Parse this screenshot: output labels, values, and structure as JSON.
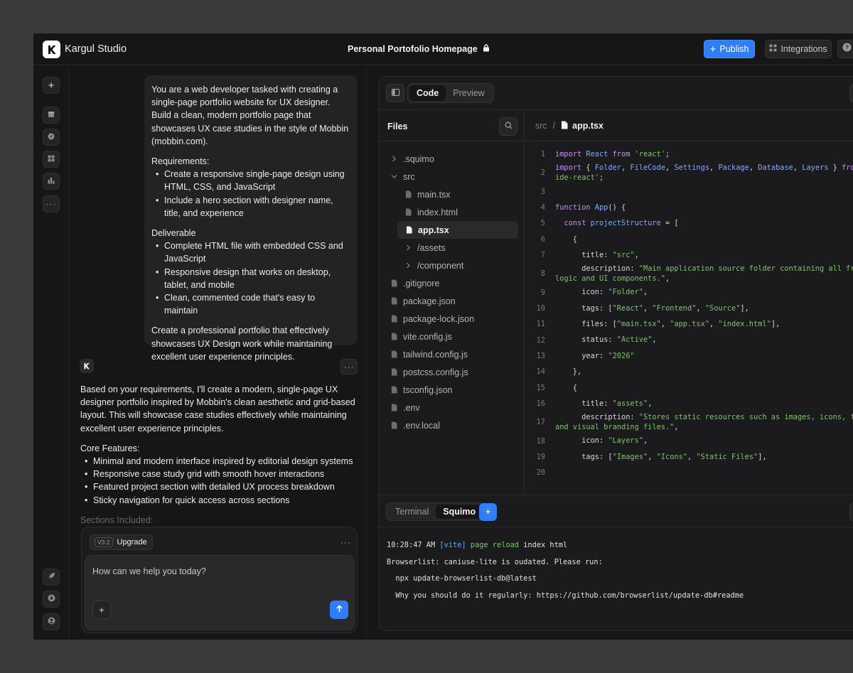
{
  "header": {
    "brand": "Kargul Studio",
    "doc_title": "Personal Portofolio Homepage",
    "publish_label": "Publish",
    "integrations_label": "Integrations"
  },
  "rail": {
    "icons": [
      "plus-icon",
      "box-icon",
      "compass-icon",
      "grid-icon",
      "bar-chart-icon",
      "more-icon",
      "rocket-icon",
      "download-icon",
      "user-icon"
    ]
  },
  "chat": {
    "user_message": {
      "intro": "You are a web developer tasked with creating a single-page portfolio website for UX designer. Build a clean, modern portfolio page that showcases UX case studies in the style of Mobbin (mobbin.com).",
      "requirements_title": "Requirements:",
      "requirements": [
        "Create a responsive single-page design using HTML, CSS, and JavaScript",
        "Include a hero section with designer name, title, and experience"
      ],
      "deliverable_title": "Deliverable",
      "deliverables": [
        "Complete HTML file with embedded CSS and JavaScript",
        "Responsive design that works on desktop, tablet, and mobile",
        "Clean, commented code that's easy to maintain"
      ],
      "closing": "Create a professional portfolio that effectively showcases UX Design work while maintaining excellent user experience principles."
    },
    "ai_message": {
      "intro": "Based on your requirements, I'll create a modern, single-page UX designer portfolio inspired by Mobbin's clean aesthetic and grid-based layout. This will showcase case studies effectively while maintaining excellent user experience principles.",
      "features_title": "Core Features:",
      "features": [
        "Minimal and modern interface inspired by editorial design systems",
        "Responsive case study grid with smooth hover interactions",
        "Featured project section with detailed UX process breakdown",
        "Sticky navigation for quick access across sections"
      ],
      "sections_title": "Sections Included:"
    },
    "composer": {
      "version": "V3.2",
      "upgrade_label": "Upgrade",
      "placeholder": "How can we help you today?"
    }
  },
  "panel": {
    "tabs": [
      "Code",
      "Preview"
    ],
    "active_tab": "Code",
    "files_title": "Files",
    "tree": [
      {
        "name": ".squimo",
        "type": "folder-collapsed",
        "depth": 0
      },
      {
        "name": "src",
        "type": "folder-open",
        "depth": 0
      },
      {
        "name": "main.tsx",
        "type": "file",
        "depth": 1
      },
      {
        "name": "index.html",
        "type": "file",
        "depth": 1
      },
      {
        "name": "app.tsx",
        "type": "file",
        "depth": 1,
        "selected": true
      },
      {
        "name": "/assets",
        "type": "folder-collapsed",
        "depth": 1
      },
      {
        "name": "/component",
        "type": "folder-collapsed",
        "depth": 1
      },
      {
        "name": ".gitignore",
        "type": "file",
        "depth": 0
      },
      {
        "name": "package.json",
        "type": "file",
        "depth": 0
      },
      {
        "name": "package-lock.json",
        "type": "file",
        "depth": 0
      },
      {
        "name": "vite.config.js",
        "type": "file",
        "depth": 0
      },
      {
        "name": "tailwind.config.js",
        "type": "file",
        "depth": 0
      },
      {
        "name": "postcss.config.js",
        "type": "file",
        "depth": 0
      },
      {
        "name": "tsconfig.json",
        "type": "file",
        "depth": 0
      },
      {
        "name": ".env",
        "type": "file",
        "depth": 0
      },
      {
        "name": ".env.local",
        "type": "file",
        "depth": 0
      }
    ],
    "breadcrumb_dir": "src",
    "breadcrumb_sep": "/",
    "breadcrumb_file": "app.tsx",
    "code_lines": [
      {
        "n": "1",
        "tokens": [
          [
            "kw",
            "import"
          ],
          [
            "p",
            " "
          ],
          [
            "id",
            "React"
          ],
          [
            "p",
            " "
          ],
          [
            "kw",
            "from"
          ],
          [
            "p",
            " "
          ],
          [
            "str",
            "'react'"
          ],
          [
            "p",
            ";"
          ]
        ]
      },
      {
        "n": "2",
        "two": true,
        "tokens": [
          [
            "kw",
            "import"
          ],
          [
            "p",
            " { "
          ],
          [
            "id",
            "Folder"
          ],
          [
            "p",
            ", "
          ],
          [
            "id",
            "FileCode"
          ],
          [
            "p",
            ", "
          ],
          [
            "id",
            "Settings"
          ],
          [
            "p",
            ", "
          ],
          [
            "id",
            "Package"
          ],
          [
            "p",
            ", "
          ],
          [
            "id",
            "Database"
          ],
          [
            "p",
            ", "
          ],
          [
            "id",
            "Layers"
          ],
          [
            "p",
            " } "
          ],
          [
            "kw",
            "from"
          ],
          [
            "p",
            " '"
          ],
          [
            "str",
            "luc\nide-react"
          ],
          [
            "str",
            "'"
          ],
          [
            "p",
            ";"
          ]
        ]
      },
      {
        "n": "3",
        "tokens": []
      },
      {
        "n": "4",
        "tokens": [
          [
            "kw",
            "function"
          ],
          [
            "p",
            " "
          ],
          [
            "id",
            "App"
          ],
          [
            "p",
            "() {"
          ]
        ]
      },
      {
        "n": "5",
        "tokens": [
          [
            "p",
            "  "
          ],
          [
            "kw",
            "const"
          ],
          [
            "p",
            " "
          ],
          [
            "id",
            "projectStructure"
          ],
          [
            "p",
            " = ["
          ]
        ]
      },
      {
        "n": "6",
        "tokens": [
          [
            "p",
            "    {"
          ]
        ]
      },
      {
        "n": "7",
        "tokens": [
          [
            "p",
            "      title: "
          ],
          [
            "str",
            "\"src\""
          ],
          [
            "p",
            ","
          ]
        ]
      },
      {
        "n": "8",
        "two": true,
        "tokens": [
          [
            "p",
            "      description: "
          ],
          [
            "str",
            "\"Main application source folder containing all front\nlogic and UI components.\""
          ],
          [
            "p",
            ","
          ]
        ]
      },
      {
        "n": "9",
        "tokens": [
          [
            "p",
            "      icon: "
          ],
          [
            "str",
            "\"Folder\""
          ],
          [
            "p",
            ","
          ]
        ]
      },
      {
        "n": "10",
        "tokens": [
          [
            "p",
            "      tags: ["
          ],
          [
            "str",
            "\"React\""
          ],
          [
            "p",
            ", "
          ],
          [
            "str",
            "\"Frontend\""
          ],
          [
            "p",
            ", "
          ],
          [
            "str",
            "\"Source\""
          ],
          [
            "p",
            "],"
          ]
        ]
      },
      {
        "n": "11",
        "tokens": [
          [
            "p",
            "      files: ["
          ],
          [
            "str",
            "\"main.tsx\""
          ],
          [
            "p",
            ", "
          ],
          [
            "str",
            "\"app.tsx\""
          ],
          [
            "p",
            ", "
          ],
          [
            "str",
            "\"index.html\""
          ],
          [
            "p",
            "],"
          ]
        ]
      },
      {
        "n": "12",
        "tokens": [
          [
            "p",
            "      status: "
          ],
          [
            "str",
            "\"Active\""
          ],
          [
            "p",
            ","
          ]
        ]
      },
      {
        "n": "13",
        "tokens": [
          [
            "p",
            "      year: "
          ],
          [
            "str",
            "\"2026\""
          ]
        ]
      },
      {
        "n": "14",
        "tokens": [
          [
            "p",
            "    },"
          ]
        ]
      },
      {
        "n": "15",
        "tokens": [
          [
            "p",
            "    {"
          ]
        ]
      },
      {
        "n": "16",
        "tokens": [
          [
            "p",
            "      title: "
          ],
          [
            "str",
            "\"assets\""
          ],
          [
            "p",
            ","
          ]
        ]
      },
      {
        "n": "17",
        "two": true,
        "tokens": [
          [
            "p",
            "      description: "
          ],
          [
            "str",
            "\"Stores static resources such as images, icons, font\nand visual branding files.\""
          ],
          [
            "p",
            ","
          ]
        ]
      },
      {
        "n": "18",
        "tokens": [
          [
            "p",
            "      icon: "
          ],
          [
            "str",
            "\"Layers\""
          ],
          [
            "p",
            ","
          ]
        ]
      },
      {
        "n": "19",
        "tokens": [
          [
            "p",
            "      tags: ["
          ],
          [
            "str",
            "\"Images\""
          ],
          [
            "p",
            ", "
          ],
          [
            "str",
            "\"Icons\""
          ],
          [
            "p",
            ", "
          ],
          [
            "str",
            "\"Static Files\""
          ],
          [
            "p",
            "],"
          ]
        ]
      },
      {
        "n": "20",
        "tokens": []
      }
    ],
    "terminal_tabs": [
      "Terminal",
      "Squimo"
    ],
    "active_terminal_tab": "Squimo",
    "terminal_lines": [
      {
        "time": "10:28:47 AM",
        "tag": "[vite]",
        "msg": "page reload",
        "rest": "index html"
      },
      {
        "text": "Browserlist: caniuse-lite is oudated. Please run:"
      },
      {
        "text": "  npx update-browserlist-db@latest"
      },
      {
        "text": "  Why you should do it regularly: https://github.com/browserlist/update-db#readme"
      }
    ]
  }
}
